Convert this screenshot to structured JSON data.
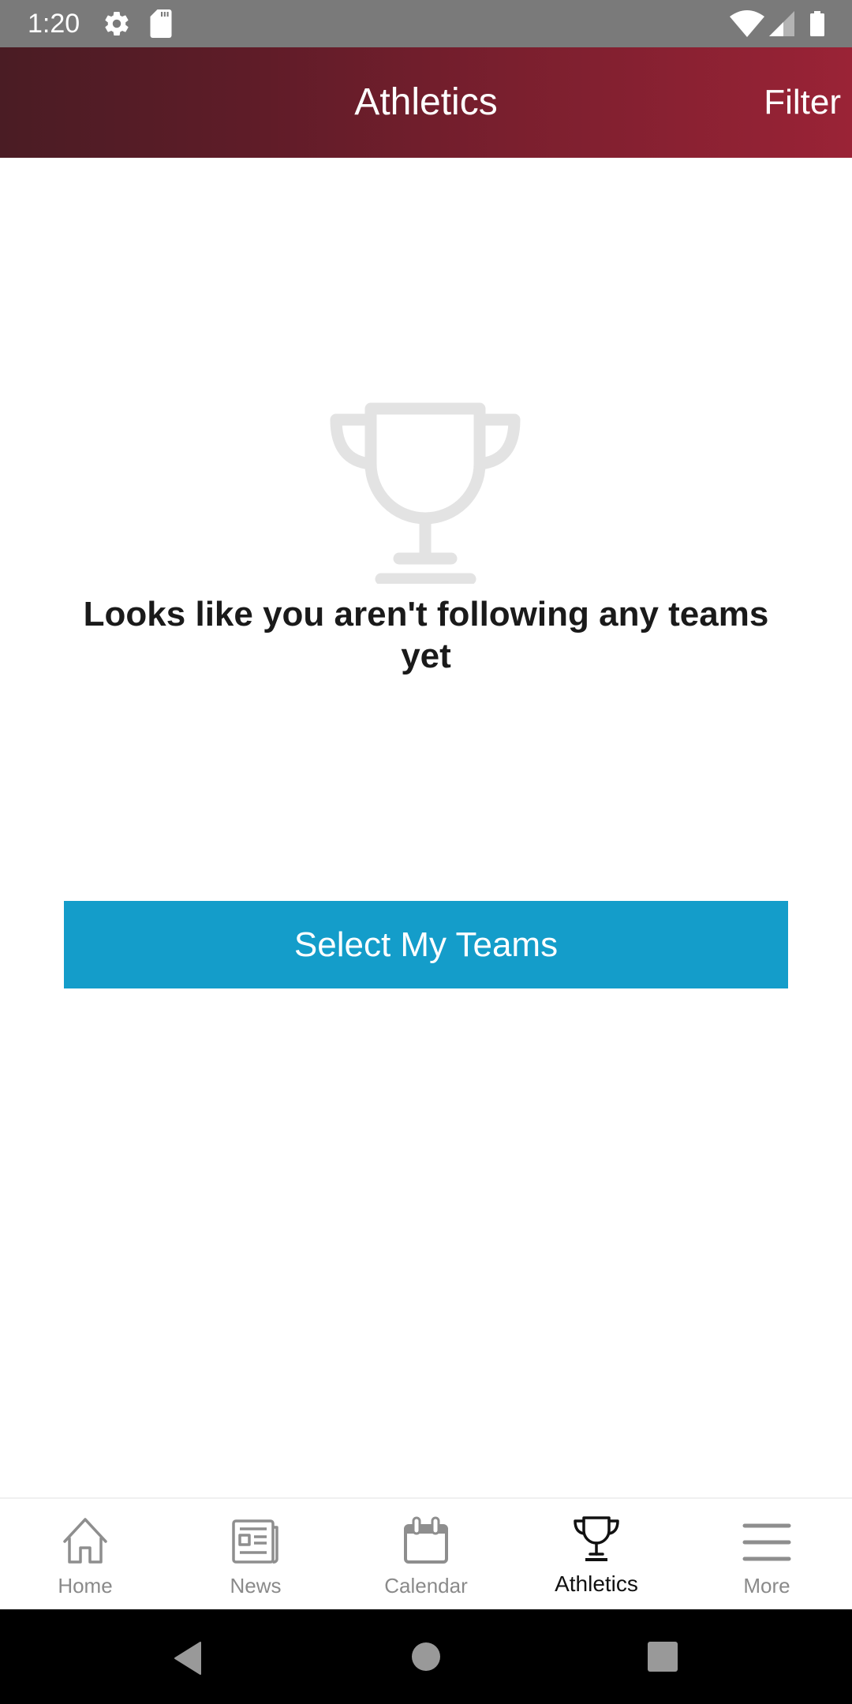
{
  "status_bar": {
    "time": "1:20",
    "left_icons": [
      "gear-icon",
      "sd-card-icon"
    ],
    "right_icons": [
      "wifi-icon",
      "cell-signal-icon",
      "battery-icon"
    ]
  },
  "header": {
    "title": "Athletics",
    "filter_label": "Filter",
    "gradient_colors": [
      "#4a1c24",
      "#9a2336"
    ]
  },
  "empty_state": {
    "icon": "trophy-icon",
    "message": "Looks like you aren't following any teams yet",
    "button_label": "Select My Teams",
    "button_color": "#149dca"
  },
  "bottom_nav": {
    "items": [
      {
        "label": "Home",
        "icon": "home-icon",
        "active": false
      },
      {
        "label": "News",
        "icon": "newspaper-icon",
        "active": false
      },
      {
        "label": "Calendar",
        "icon": "calendar-icon",
        "active": false
      },
      {
        "label": "Athletics",
        "icon": "trophy-icon",
        "active": true
      },
      {
        "label": "More",
        "icon": "menu-icon",
        "active": false
      }
    ]
  },
  "system_nav": {
    "buttons": [
      "back",
      "home",
      "recents"
    ]
  }
}
